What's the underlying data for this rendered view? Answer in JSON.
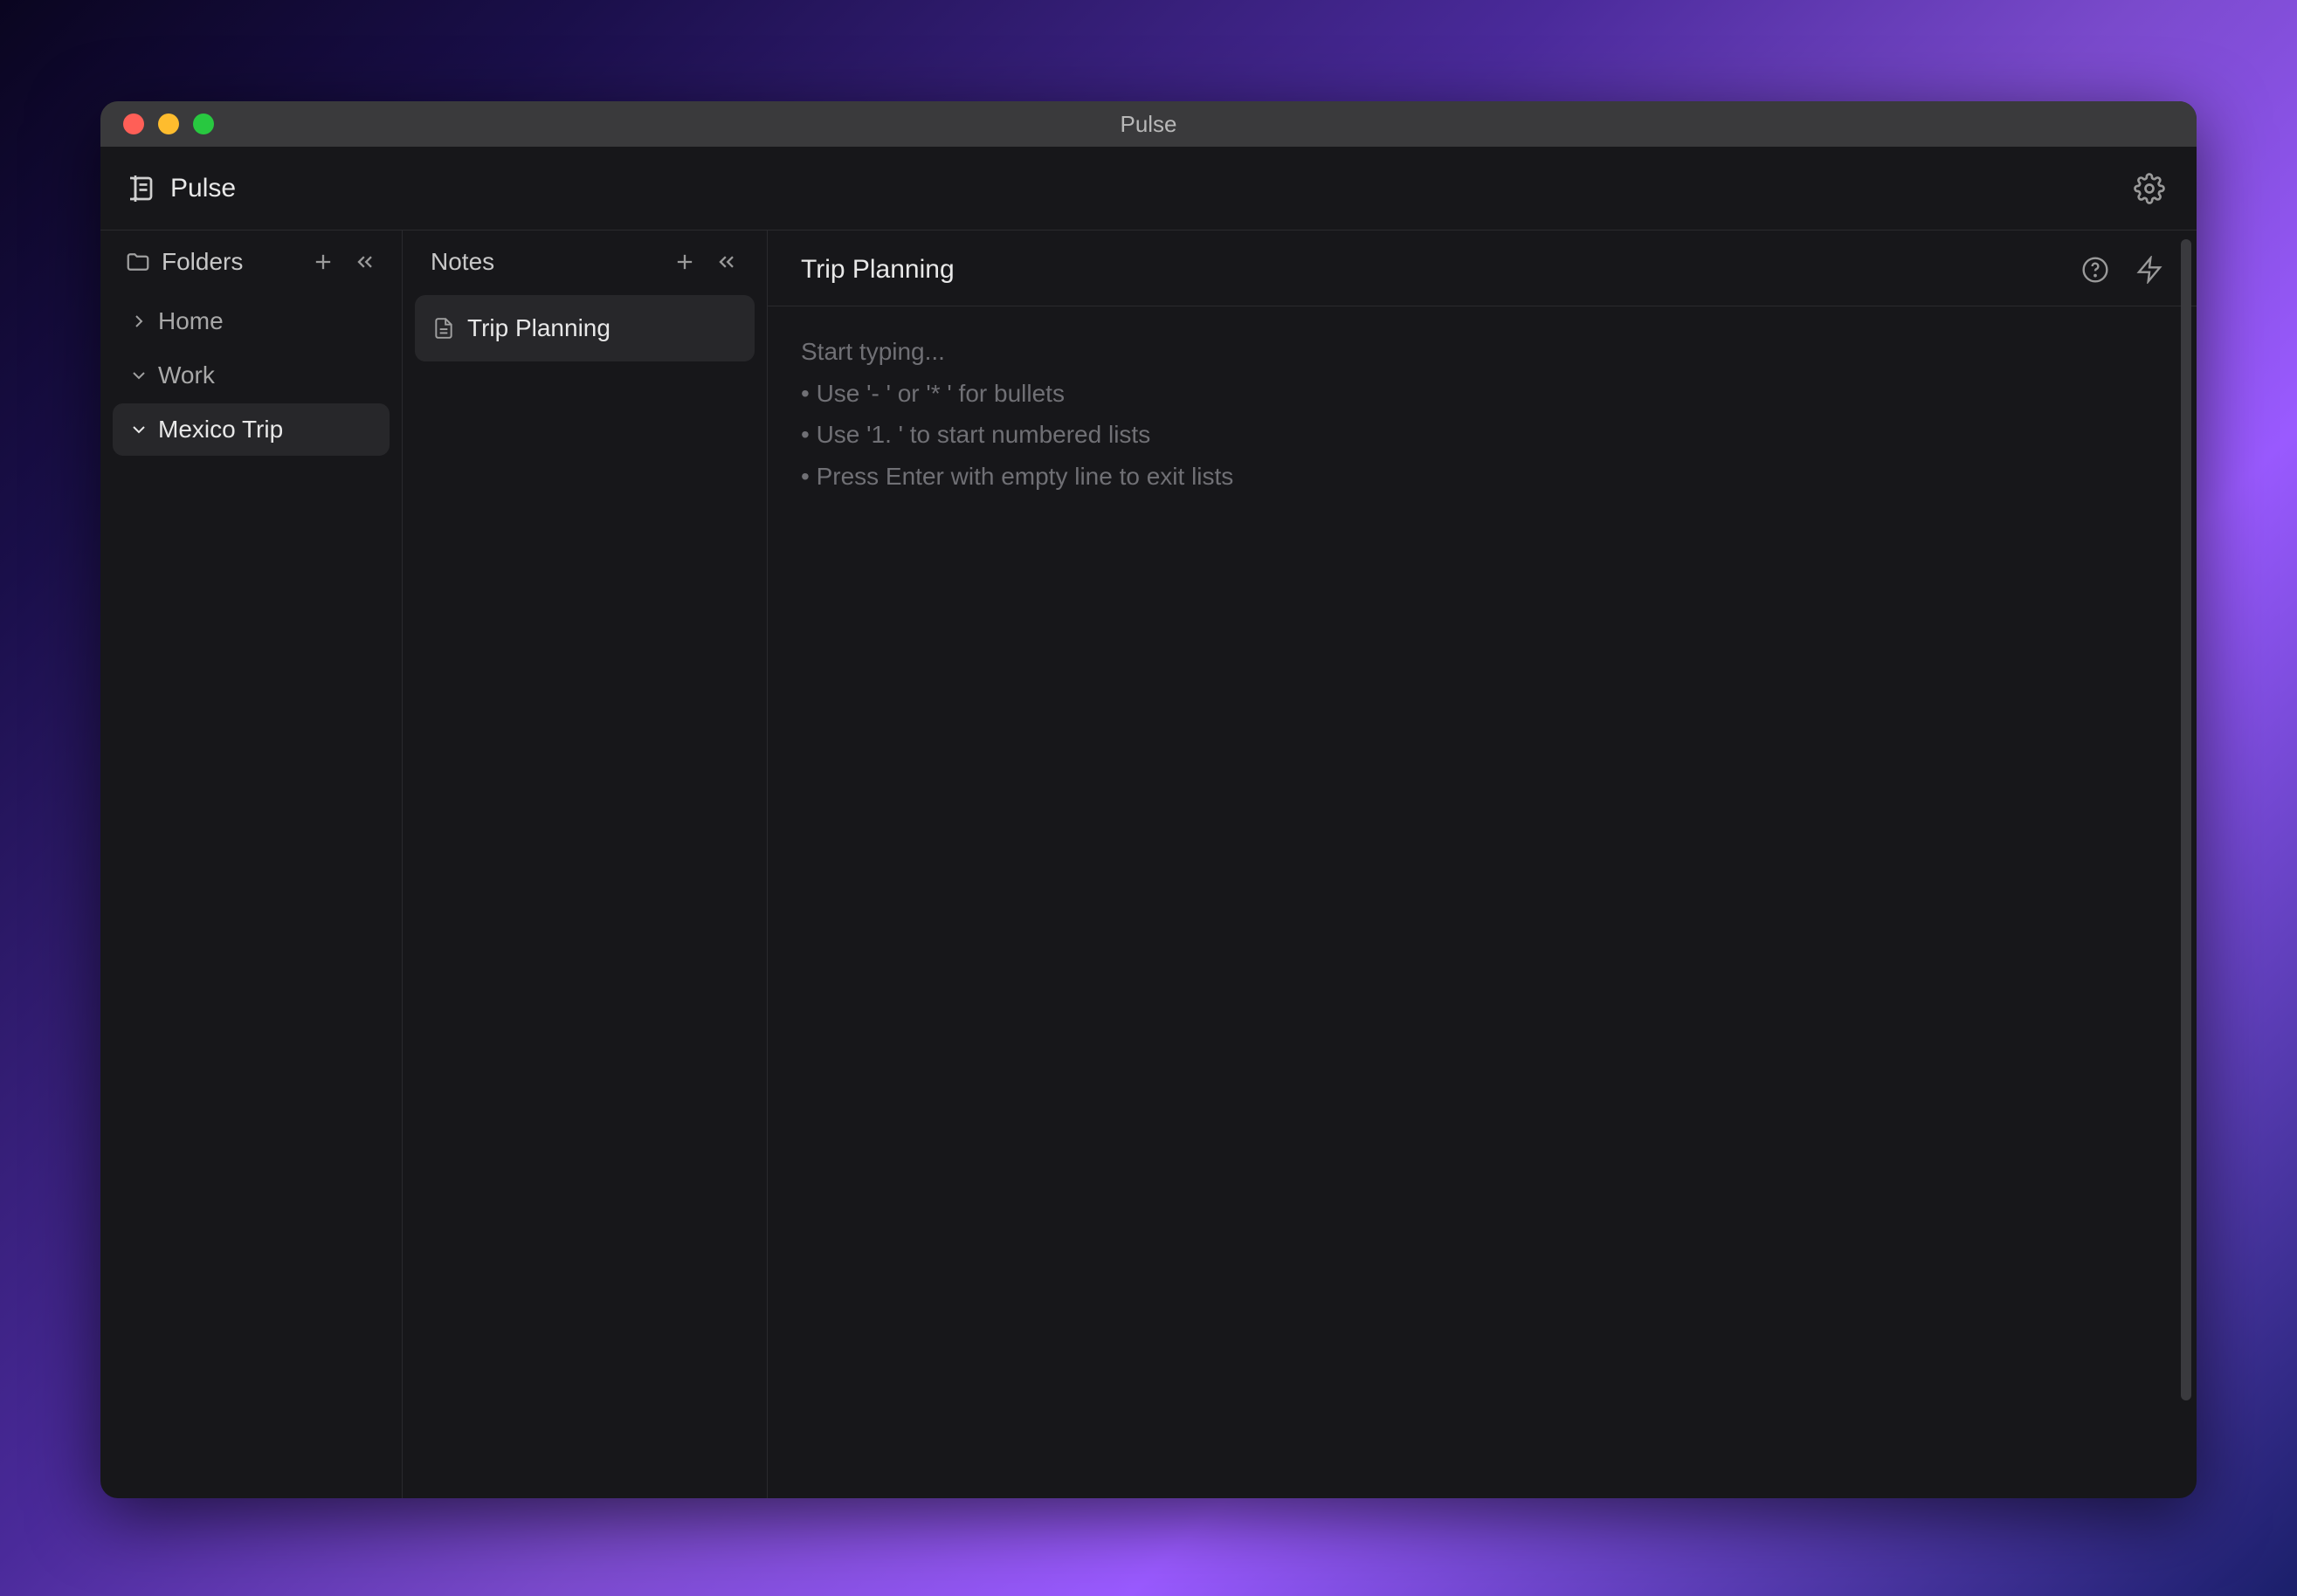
{
  "app": {
    "name": "Pulse",
    "window_title": "Pulse"
  },
  "sidebar": {
    "title": "Folders",
    "folders": [
      {
        "name": "Home",
        "expanded": false,
        "selected": false
      },
      {
        "name": "Work",
        "expanded": true,
        "selected": false
      },
      {
        "name": "Mexico Trip",
        "expanded": true,
        "selected": true
      }
    ]
  },
  "notes_panel": {
    "title": "Notes",
    "notes": [
      {
        "name": "Trip Planning",
        "selected": true
      }
    ]
  },
  "editor": {
    "title": "Trip Planning",
    "placeholder": "Start typing...\n• Use '- ' or '* ' for bullets\n• Use '1. ' to start numbered lists\n• Press Enter with empty line to exit lists"
  }
}
